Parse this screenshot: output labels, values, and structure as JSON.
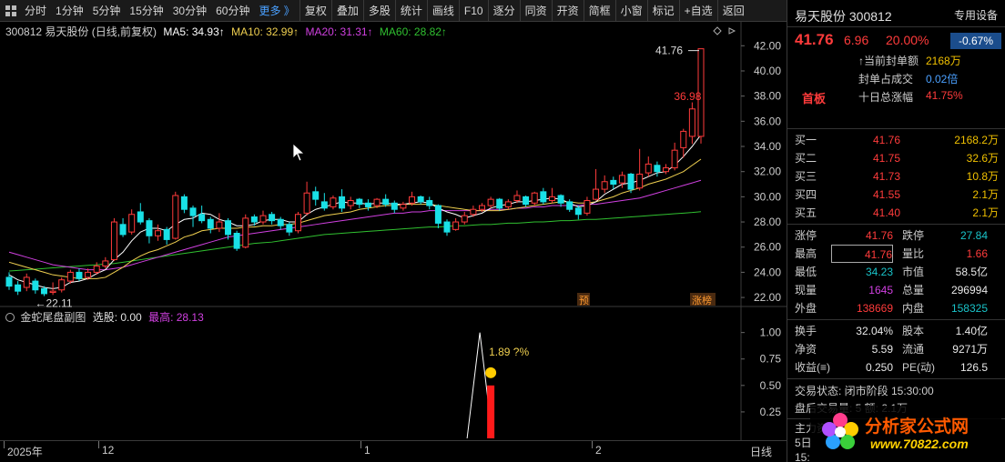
{
  "toolbar": {
    "items": [
      "分时",
      "1分钟",
      "5分钟",
      "15分钟",
      "30分钟",
      "60分钟",
      "更多 》",
      "复权",
      "叠加",
      "多股",
      "统计",
      "画线",
      "F10",
      "逐分",
      "同资",
      "开资",
      "简框",
      "小窗",
      "标记",
      "+自选",
      "返回"
    ]
  },
  "main_legend": {
    "code_name": "300812 易天股份 (日线,前复权)",
    "ma5": "MA5: 34.93↑",
    "ma10": "MA10: 32.99↑",
    "ma20": "MA20: 31.31↑",
    "ma60": "MA60: 28.82↑"
  },
  "sub_legend": {
    "name": "金蛇尾盘副图",
    "select": "选股: 0.00",
    "high": "最高: 28.13"
  },
  "annotations": {
    "max_label": "41.76",
    "min_label": "←22.11",
    "mid_label": "36.98",
    "sub_label": "1.89 ?%",
    "pre_tag": "预",
    "zhangbang_tag": "涨榜"
  },
  "price_axis": [
    "42.00",
    "40.00",
    "38.00",
    "36.00",
    "34.00",
    "32.00",
    "30.00",
    "28.00",
    "26.00",
    "24.00",
    "22.00"
  ],
  "sub_axis": [
    "1.00",
    "0.75",
    "0.50",
    "0.25"
  ],
  "date_axis": {
    "labels": [
      "2025年",
      "12",
      "1",
      "2"
    ],
    "period": "日线"
  },
  "colors": {
    "up": "#ff3b3b",
    "down": "#19e0e6",
    "ma5": "#ffffff",
    "ma10": "#f0d050",
    "ma20": "#d040e0",
    "ma60": "#30c030"
  },
  "panel": {
    "name": "易天股份  300812",
    "special": "专用设备",
    "pct_badge": "-0.67%",
    "price": "41.76",
    "change": "6.96",
    "change_pct": "20.00%",
    "seal": [
      {
        "label": "↑当前封单额",
        "value": "2168万"
      },
      {
        "label": "封单占成交",
        "value": "0.02倍"
      },
      {
        "label": "十日总涨幅",
        "value": "41.75%"
      }
    ],
    "first_board": "首板",
    "book": [
      {
        "label": "买一",
        "price": "41.76",
        "vol": "2168.2万"
      },
      {
        "label": "买二",
        "price": "41.75",
        "vol": "32.6万"
      },
      {
        "label": "买三",
        "price": "41.73",
        "vol": "10.8万"
      },
      {
        "label": "买四",
        "price": "41.55",
        "vol": "2.1万"
      },
      {
        "label": "买五",
        "price": "41.40",
        "vol": "2.1万"
      }
    ],
    "quote1": [
      {
        "l": "涨停",
        "v": "41.76",
        "vc": "red",
        "l2": "跌停",
        "v2": "27.84",
        "v2c": "green"
      },
      {
        "l": "最高",
        "v": "41.76",
        "vc": "red",
        "l2": "量比",
        "v2": "1.66",
        "v2c": "red"
      },
      {
        "l": "最低",
        "v": "34.23",
        "vc": "green",
        "l2": "市值",
        "v2": "58.5亿",
        "v2c": "white"
      },
      {
        "l": "现量",
        "v": "1645",
        "vc": "purple",
        "l2": "总量",
        "v2": "296994",
        "v2c": "white"
      },
      {
        "l": "外盘",
        "v": "138669",
        "vc": "red",
        "l2": "内盘",
        "v2": "158325",
        "v2c": "green"
      }
    ],
    "quote2": [
      {
        "l": "换手",
        "v": "32.04%",
        "l2": "股本",
        "v2": "1.40亿"
      },
      {
        "l": "净资",
        "v": "5.59",
        "l2": "流通",
        "v2": "9271万"
      },
      {
        "l": "收益(≡)",
        "v": "0.250",
        "l2": "PE(动)",
        "v2": "126.5"
      }
    ],
    "status": "交易状态: 闭市阶段 15:30:00",
    "after_hours": "盘后交易量: 5  额: 2.1万",
    "main_fund": "主力资金",
    "five_day": "5日",
    "time": "15:",
    "watermark_1": "分析家公式网",
    "watermark_2": "www.70822.com"
  },
  "chart_data": {
    "type": "candlestick",
    "ylim": [
      21.5,
      42.6
    ],
    "candles": [
      {
        "o": 23.6,
        "c": 22.9,
        "h": 24.0,
        "l": 22.6
      },
      {
        "o": 23.0,
        "c": 22.5,
        "h": 23.3,
        "l": 22.2
      },
      {
        "o": 22.8,
        "c": 23.6,
        "h": 23.9,
        "l": 22.5
      },
      {
        "o": 23.3,
        "c": 22.6,
        "h": 23.5,
        "l": 22.3
      },
      {
        "o": 22.7,
        "c": 22.3,
        "h": 22.9,
        "l": 22.11
      },
      {
        "o": 22.4,
        "c": 22.5,
        "h": 23.2,
        "l": 22.2
      },
      {
        "o": 22.6,
        "c": 23.4,
        "h": 23.6,
        "l": 22.4
      },
      {
        "o": 23.3,
        "c": 24.0,
        "h": 24.2,
        "l": 23.1
      },
      {
        "o": 24.0,
        "c": 23.5,
        "h": 24.3,
        "l": 23.3
      },
      {
        "o": 23.6,
        "c": 24.0,
        "h": 24.3,
        "l": 23.4
      },
      {
        "o": 24.0,
        "c": 24.5,
        "h": 24.8,
        "l": 23.8
      },
      {
        "o": 24.5,
        "c": 24.9,
        "h": 25.2,
        "l": 24.3
      },
      {
        "o": 25.0,
        "c": 28.0,
        "h": 28.3,
        "l": 24.9
      },
      {
        "o": 27.8,
        "c": 27.0,
        "h": 28.3,
        "l": 26.8
      },
      {
        "o": 27.2,
        "c": 28.6,
        "h": 29.0,
        "l": 27.0
      },
      {
        "o": 28.8,
        "c": 28.0,
        "h": 29.5,
        "l": 27.8
      },
      {
        "o": 28.1,
        "c": 26.9,
        "h": 28.3,
        "l": 26.3
      },
      {
        "o": 26.9,
        "c": 27.3,
        "h": 27.8,
        "l": 26.5
      },
      {
        "o": 27.4,
        "c": 26.6,
        "h": 27.6,
        "l": 26.2
      },
      {
        "o": 26.7,
        "c": 30.1,
        "h": 30.4,
        "l": 26.6
      },
      {
        "o": 30.0,
        "c": 29.0,
        "h": 30.2,
        "l": 28.7
      },
      {
        "o": 29.1,
        "c": 28.5,
        "h": 29.3,
        "l": 27.6
      },
      {
        "o": 28.6,
        "c": 28.1,
        "h": 29.3,
        "l": 27.9
      },
      {
        "o": 28.2,
        "c": 27.5,
        "h": 28.4,
        "l": 27.1
      },
      {
        "o": 27.5,
        "c": 28.0,
        "h": 28.7,
        "l": 27.2
      },
      {
        "o": 28.1,
        "c": 27.0,
        "h": 28.3,
        "l": 26.6
      },
      {
        "o": 27.1,
        "c": 25.9,
        "h": 27.3,
        "l": 25.7
      },
      {
        "o": 26.0,
        "c": 28.3,
        "h": 28.6,
        "l": 25.9
      },
      {
        "o": 28.4,
        "c": 28.0,
        "h": 28.6,
        "l": 27.7
      },
      {
        "o": 28.0,
        "c": 28.5,
        "h": 28.9,
        "l": 27.8
      },
      {
        "o": 28.6,
        "c": 28.1,
        "h": 28.8,
        "l": 27.8
      },
      {
        "o": 28.2,
        "c": 27.7,
        "h": 28.4,
        "l": 27.4
      },
      {
        "o": 27.8,
        "c": 27.2,
        "h": 28.0,
        "l": 26.9
      },
      {
        "o": 27.3,
        "c": 28.6,
        "h": 28.8,
        "l": 27.1
      },
      {
        "o": 28.7,
        "c": 30.3,
        "h": 31.2,
        "l": 28.5
      },
      {
        "o": 30.4,
        "c": 29.8,
        "h": 30.8,
        "l": 29.3
      },
      {
        "o": 29.6,
        "c": 29.1,
        "h": 30.3,
        "l": 28.9
      },
      {
        "o": 29.2,
        "c": 29.9,
        "h": 30.1,
        "l": 29.0
      },
      {
        "o": 30.0,
        "c": 29.1,
        "h": 30.6,
        "l": 28.8
      },
      {
        "o": 29.3,
        "c": 29.7,
        "h": 30.0,
        "l": 29.0
      },
      {
        "o": 29.8,
        "c": 29.4,
        "h": 29.9,
        "l": 29.1
      },
      {
        "o": 29.5,
        "c": 29.2,
        "h": 29.8,
        "l": 28.9
      },
      {
        "o": 29.3,
        "c": 29.8,
        "h": 29.9,
        "l": 29.1
      },
      {
        "o": 29.8,
        "c": 29.4,
        "h": 30.2,
        "l": 29.2
      },
      {
        "o": 29.5,
        "c": 29.0,
        "h": 29.7,
        "l": 28.7
      },
      {
        "o": 29.1,
        "c": 29.4,
        "h": 29.6,
        "l": 28.9
      },
      {
        "o": 29.5,
        "c": 30.0,
        "h": 30.4,
        "l": 29.3
      },
      {
        "o": 30.0,
        "c": 29.6,
        "h": 30.1,
        "l": 29.4
      },
      {
        "o": 29.7,
        "c": 29.3,
        "h": 30.0,
        "l": 29.0
      },
      {
        "o": 29.3,
        "c": 27.9,
        "h": 29.4,
        "l": 27.5
      },
      {
        "o": 28.0,
        "c": 27.2,
        "h": 28.2,
        "l": 26.9
      },
      {
        "o": 27.4,
        "c": 28.0,
        "h": 28.3,
        "l": 27.3
      },
      {
        "o": 28.0,
        "c": 28.5,
        "h": 28.8,
        "l": 27.8
      },
      {
        "o": 28.6,
        "c": 29.0,
        "h": 29.3,
        "l": 28.4
      },
      {
        "o": 29.0,
        "c": 29.3,
        "h": 29.5,
        "l": 28.8
      },
      {
        "o": 29.3,
        "c": 29.8,
        "h": 30.0,
        "l": 29.1
      },
      {
        "o": 29.8,
        "c": 29.1,
        "h": 29.9,
        "l": 28.9
      },
      {
        "o": 29.2,
        "c": 29.6,
        "h": 29.8,
        "l": 29.0
      },
      {
        "o": 29.7,
        "c": 30.1,
        "h": 30.5,
        "l": 29.5
      },
      {
        "o": 30.0,
        "c": 29.4,
        "h": 30.1,
        "l": 29.2
      },
      {
        "o": 29.5,
        "c": 30.3,
        "h": 30.4,
        "l": 29.3
      },
      {
        "o": 30.4,
        "c": 29.6,
        "h": 30.7,
        "l": 29.4
      },
      {
        "o": 29.7,
        "c": 30.0,
        "h": 30.7,
        "l": 29.5
      },
      {
        "o": 30.1,
        "c": 29.5,
        "h": 30.2,
        "l": 29.2
      },
      {
        "o": 29.6,
        "c": 29.0,
        "h": 29.8,
        "l": 28.8
      },
      {
        "o": 29.1,
        "c": 28.6,
        "h": 29.3,
        "l": 28.2
      },
      {
        "o": 28.7,
        "c": 29.7,
        "h": 30.0,
        "l": 28.5
      },
      {
        "o": 29.8,
        "c": 30.6,
        "h": 32.2,
        "l": 29.7
      },
      {
        "o": 30.6,
        "c": 31.2,
        "h": 31.7,
        "l": 30.3
      },
      {
        "o": 31.3,
        "c": 31.0,
        "h": 31.6,
        "l": 30.6
      },
      {
        "o": 31.1,
        "c": 31.7,
        "h": 32.0,
        "l": 30.7
      },
      {
        "o": 31.8,
        "c": 30.6,
        "h": 31.9,
        "l": 30.3
      },
      {
        "o": 30.7,
        "c": 31.8,
        "h": 33.8,
        "l": 30.5
      },
      {
        "o": 31.9,
        "c": 32.6,
        "h": 33.2,
        "l": 31.6
      },
      {
        "o": 32.5,
        "c": 32.0,
        "h": 32.8,
        "l": 31.6
      },
      {
        "o": 32.0,
        "c": 32.3,
        "h": 32.6,
        "l": 31.8
      },
      {
        "o": 32.3,
        "c": 33.7,
        "h": 34.3,
        "l": 32.1
      },
      {
        "o": 33.9,
        "c": 35.2,
        "h": 35.4,
        "l": 33.1
      },
      {
        "o": 34.8,
        "c": 36.98,
        "h": 37.5,
        "l": 34.2
      },
      {
        "o": 34.8,
        "c": 41.76,
        "h": 41.76,
        "l": 34.23
      }
    ],
    "ma5": [
      23.8,
      23.4,
      23.2,
      23.0,
      22.8,
      22.7,
      22.8,
      23.2,
      23.3,
      23.5,
      23.9,
      24.2,
      25.0,
      25.6,
      26.5,
      27.2,
      27.5,
      27.5,
      27.3,
      27.8,
      28.2,
      28.3,
      28.7,
      28.6,
      28.2,
      28.0,
      27.7,
      27.7,
      27.8,
      28.1,
      28.2,
      28.2,
      28.0,
      28.0,
      28.6,
      29.0,
      29.2,
      29.4,
      29.6,
      29.5,
      29.5,
      29.4,
      29.5,
      29.5,
      29.4,
      29.4,
      29.5,
      29.6,
      29.5,
      29.1,
      28.8,
      28.6,
      28.3,
      28.5,
      28.7,
      29.1,
      29.3,
      29.4,
      29.6,
      29.6,
      29.7,
      29.8,
      29.9,
      29.8,
      29.5,
      29.2,
      29.3,
      29.6,
      30.2,
      30.6,
      31.0,
      31.1,
      31.3,
      31.6,
      31.9,
      32.0,
      32.5,
      33.2,
      34.0,
      34.93
    ],
    "ma10": [
      24.8,
      24.6,
      24.4,
      24.2,
      24.0,
      23.8,
      23.7,
      23.6,
      23.5,
      23.5,
      23.5,
      23.6,
      24.0,
      24.4,
      24.9,
      25.3,
      25.6,
      25.8,
      26.1,
      26.4,
      26.8,
      27.0,
      27.3,
      27.4,
      27.5,
      27.5,
      27.5,
      27.6,
      27.6,
      27.7,
      27.7,
      27.8,
      27.8,
      27.9,
      28.1,
      28.3,
      28.5,
      28.6,
      28.7,
      28.8,
      29.0,
      29.1,
      29.2,
      29.3,
      29.3,
      29.4,
      29.4,
      29.4,
      29.4,
      29.3,
      29.2,
      29.1,
      29.0,
      28.9,
      28.9,
      28.9,
      28.9,
      29.0,
      29.1,
      29.2,
      29.3,
      29.4,
      29.5,
      29.6,
      29.6,
      29.5,
      29.5,
      29.6,
      29.8,
      30.0,
      30.3,
      30.5,
      30.7,
      31.0,
      31.2,
      31.4,
      31.7,
      32.0,
      32.5,
      32.99
    ],
    "ma20": [
      25.6,
      25.4,
      25.2,
      25.0,
      24.8,
      24.6,
      24.5,
      24.4,
      24.3,
      24.2,
      24.2,
      24.2,
      24.3,
      24.4,
      24.6,
      24.8,
      25.0,
      25.2,
      25.4,
      25.6,
      25.8,
      26.0,
      26.2,
      26.4,
      26.6,
      26.8,
      26.9,
      27.0,
      27.1,
      27.2,
      27.3,
      27.4,
      27.5,
      27.6,
      27.7,
      27.8,
      27.9,
      28.0,
      28.1,
      28.2,
      28.3,
      28.4,
      28.5,
      28.6,
      28.7,
      28.7,
      28.8,
      28.8,
      28.9,
      28.9,
      28.9,
      28.9,
      28.9,
      28.9,
      28.9,
      29.0,
      29.0,
      29.0,
      29.1,
      29.1,
      29.2,
      29.2,
      29.3,
      29.3,
      29.3,
      29.3,
      29.4,
      29.4,
      29.5,
      29.6,
      29.7,
      29.8,
      29.9,
      30.1,
      30.3,
      30.5,
      30.7,
      30.9,
      31.1,
      31.31
    ],
    "ma60": [
      24.1,
      24.15,
      24.2,
      24.25,
      24.3,
      24.35,
      24.4,
      24.45,
      24.5,
      24.55,
      24.6,
      24.65,
      24.7,
      24.8,
      24.9,
      25.0,
      25.1,
      25.2,
      25.3,
      25.4,
      25.5,
      25.6,
      25.7,
      25.8,
      25.9,
      26.0,
      26.1,
      26.2,
      26.3,
      26.35,
      26.4,
      26.5,
      26.6,
      26.7,
      26.8,
      26.9,
      27.0,
      27.05,
      27.1,
      27.15,
      27.2,
      27.25,
      27.3,
      27.35,
      27.4,
      27.45,
      27.5,
      27.55,
      27.6,
      27.6,
      27.65,
      27.7,
      27.7,
      27.75,
      27.8,
      27.8,
      27.85,
      27.9,
      27.9,
      27.95,
      28.0,
      28.0,
      28.05,
      28.1,
      28.1,
      28.15,
      28.2,
      28.2,
      28.25,
      28.3,
      28.35,
      28.4,
      28.45,
      28.5,
      28.55,
      28.6,
      28.65,
      28.7,
      28.75,
      28.82
    ],
    "sub_series": {
      "spike_index": 55,
      "spike_value": 1.0,
      "bar_value": 0.5,
      "ylim": [
        0,
        1.1
      ]
    }
  }
}
